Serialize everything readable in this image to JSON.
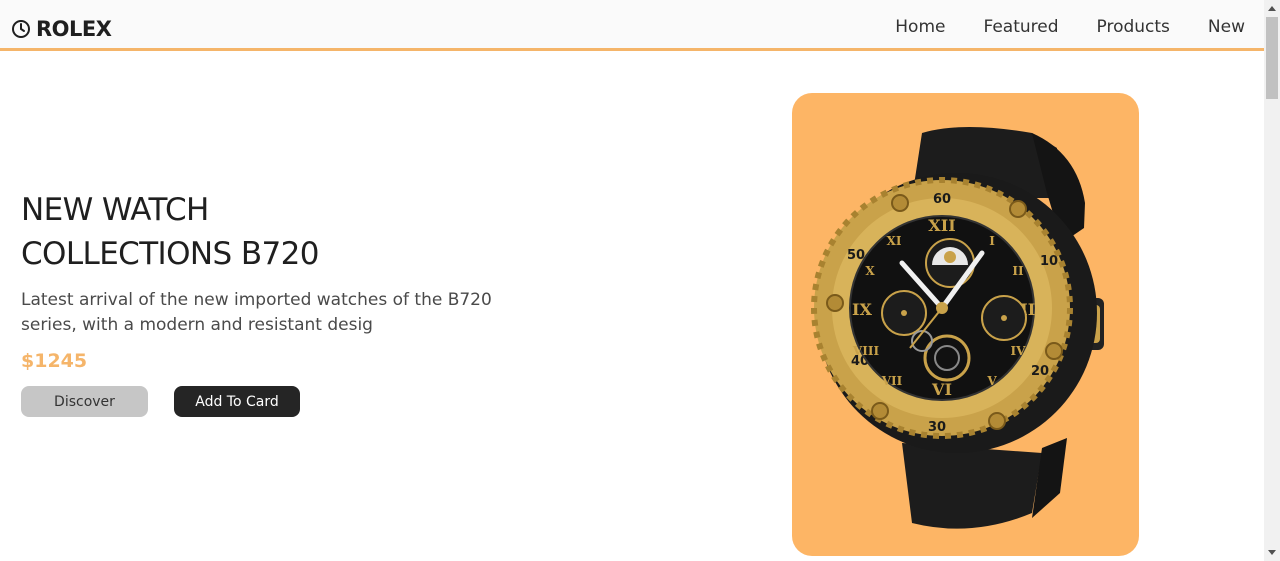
{
  "header": {
    "logo_text": "ROLEX",
    "logo_icon": "clock-icon",
    "nav": [
      {
        "label": "Home"
      },
      {
        "label": "Featured"
      },
      {
        "label": "Products"
      },
      {
        "label": "New"
      }
    ]
  },
  "hero": {
    "title": "NEW WATCH COLLECTIONS B720",
    "description": "Latest arrival of the new imported watches of the B720 series, with a modern and resistant desig",
    "price": "$1245",
    "buttons": {
      "discover": "Discover",
      "add_to_card": "Add To Card"
    }
  },
  "product_image": {
    "icon": "watch-image",
    "background_color": "#fdb565"
  },
  "colors": {
    "accent": "#f5b56a",
    "dark": "#252525",
    "button_gray": "#c6c6c6"
  }
}
